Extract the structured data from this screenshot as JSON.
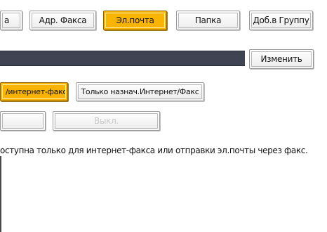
{
  "tabs": {
    "cut_label": "a",
    "fax_address": "Адр. Факса",
    "email": "Эл.почта",
    "folder": "Папка",
    "add_to_group": "Доб.в Группу"
  },
  "name_field": {
    "change_button": "Изменить"
  },
  "send_via": {
    "internet_fax_cut": "/интернет-факс",
    "only_dest_internet_fax": "Только назнач.Интернет/Факс"
  },
  "toggle": {
    "on_label": "",
    "off_label": "Выкл."
  },
  "info_text": "оступна только для интернет-факса или отправки эл.почты через факс.",
  "colors": {
    "selected": "#f8b400",
    "name_bar": "#3f4352"
  }
}
